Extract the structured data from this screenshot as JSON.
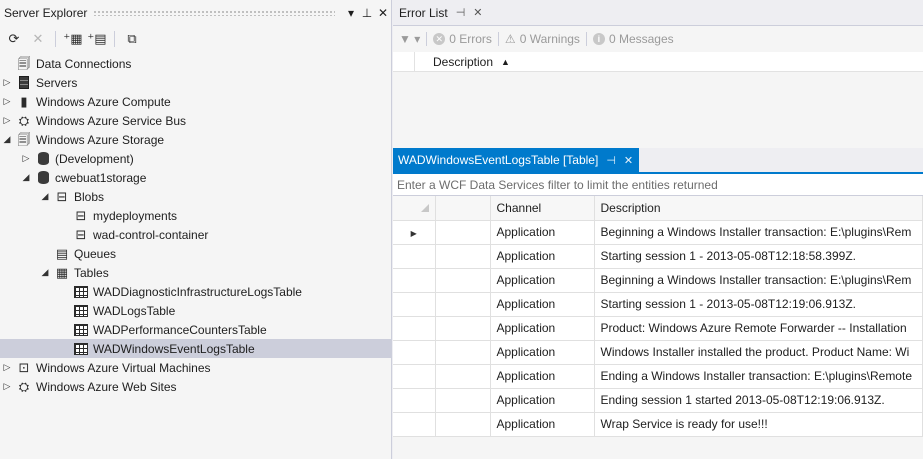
{
  "server_explorer": {
    "title": "Server Explorer",
    "tree": [
      {
        "label": "Data Connections",
        "icon": "data-connections-icon",
        "depth": 0,
        "expander": "none"
      },
      {
        "label": "Servers",
        "icon": "servers-icon",
        "depth": 0,
        "expander": "collapsed"
      },
      {
        "label": "Windows Azure Compute",
        "icon": "azure-compute-icon",
        "depth": 0,
        "expander": "collapsed"
      },
      {
        "label": "Windows Azure Service Bus",
        "icon": "service-bus-icon",
        "depth": 0,
        "expander": "collapsed"
      },
      {
        "label": "Windows Azure Storage",
        "icon": "azure-storage-icon",
        "depth": 0,
        "expander": "expanded"
      },
      {
        "label": "(Development)",
        "icon": "storage-account-icon",
        "depth": 1,
        "expander": "collapsed"
      },
      {
        "label": "cwebuat1storage",
        "icon": "storage-account-icon",
        "depth": 1,
        "expander": "expanded"
      },
      {
        "label": "Blobs",
        "icon": "blobs-icon",
        "depth": 2,
        "expander": "expanded"
      },
      {
        "label": "mydeployments",
        "icon": "blob-container-icon",
        "depth": 3,
        "expander": "none"
      },
      {
        "label": "wad-control-container",
        "icon": "blob-container-icon",
        "depth": 3,
        "expander": "none"
      },
      {
        "label": "Queues",
        "icon": "queues-icon",
        "depth": 2,
        "expander": "none"
      },
      {
        "label": "Tables",
        "icon": "tables-icon",
        "depth": 2,
        "expander": "expanded"
      },
      {
        "label": "WADDiagnosticInfrastructureLogsTable",
        "icon": "table-icon",
        "depth": 3,
        "expander": "none"
      },
      {
        "label": "WADLogsTable",
        "icon": "table-icon",
        "depth": 3,
        "expander": "none"
      },
      {
        "label": "WADPerformanceCountersTable",
        "icon": "table-icon",
        "depth": 3,
        "expander": "none"
      },
      {
        "label": "WADWindowsEventLogsTable",
        "icon": "table-icon",
        "depth": 3,
        "expander": "none",
        "selected": true
      },
      {
        "label": "Windows Azure Virtual Machines",
        "icon": "virtual-machines-icon",
        "depth": 0,
        "expander": "collapsed"
      },
      {
        "label": "Windows Azure Web Sites",
        "icon": "web-sites-icon",
        "depth": 0,
        "expander": "collapsed"
      }
    ]
  },
  "error_list": {
    "tab_label": "Error List",
    "errors": "0 Errors",
    "warnings": "0 Warnings",
    "messages": "0 Messages",
    "column": "Description"
  },
  "table_view": {
    "tab_label": "WADWindowsEventLogsTable [Table]",
    "filter_placeholder": "Enter a WCF Data Services filter to limit the entities returned",
    "columns": [
      "Channel",
      "Description"
    ],
    "rows": [
      {
        "channel": "Application",
        "description": "Beginning a Windows Installer transaction: E:\\plugins\\Rem",
        "current": true
      },
      {
        "channel": "Application",
        "description": "Starting session 1 - 2013-05-08T12:18:58.399Z."
      },
      {
        "channel": "Application",
        "description": "Beginning a Windows Installer transaction: E:\\plugins\\Rem"
      },
      {
        "channel": "Application",
        "description": "Starting session 1 - 2013-05-08T12:19:06.913Z."
      },
      {
        "channel": "Application",
        "description": "Product: Windows Azure Remote Forwarder -- Installation"
      },
      {
        "channel": "Application",
        "description": "Windows Installer installed the product. Product Name: Wi"
      },
      {
        "channel": "Application",
        "description": "Ending a Windows Installer transaction: E:\\plugins\\Remote"
      },
      {
        "channel": "Application",
        "description": "Ending session 1 started 2013-05-08T12:19:06.913Z."
      },
      {
        "channel": "Application",
        "description": "Wrap Service is ready for use!!!"
      }
    ]
  }
}
